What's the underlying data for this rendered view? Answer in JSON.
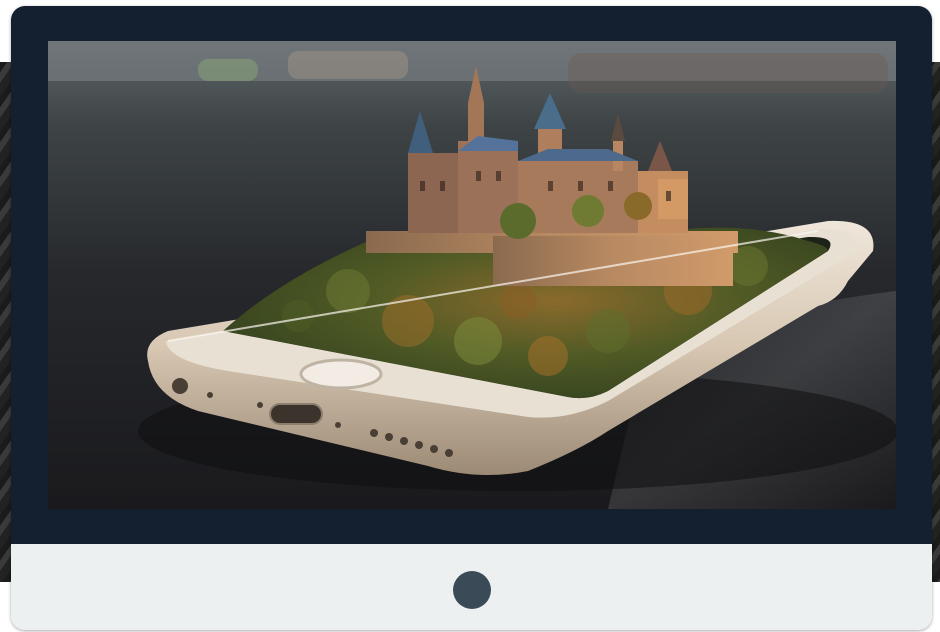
{
  "monitor": {
    "bezel_color": "#142030",
    "chin_color": "#edf0f1",
    "power_button_color": "#3b4a57",
    "power_button_icon": "power-button-icon"
  },
  "screen": {
    "image_subject": "castle-on-forested-hill-emerging-from-smartphone"
  }
}
